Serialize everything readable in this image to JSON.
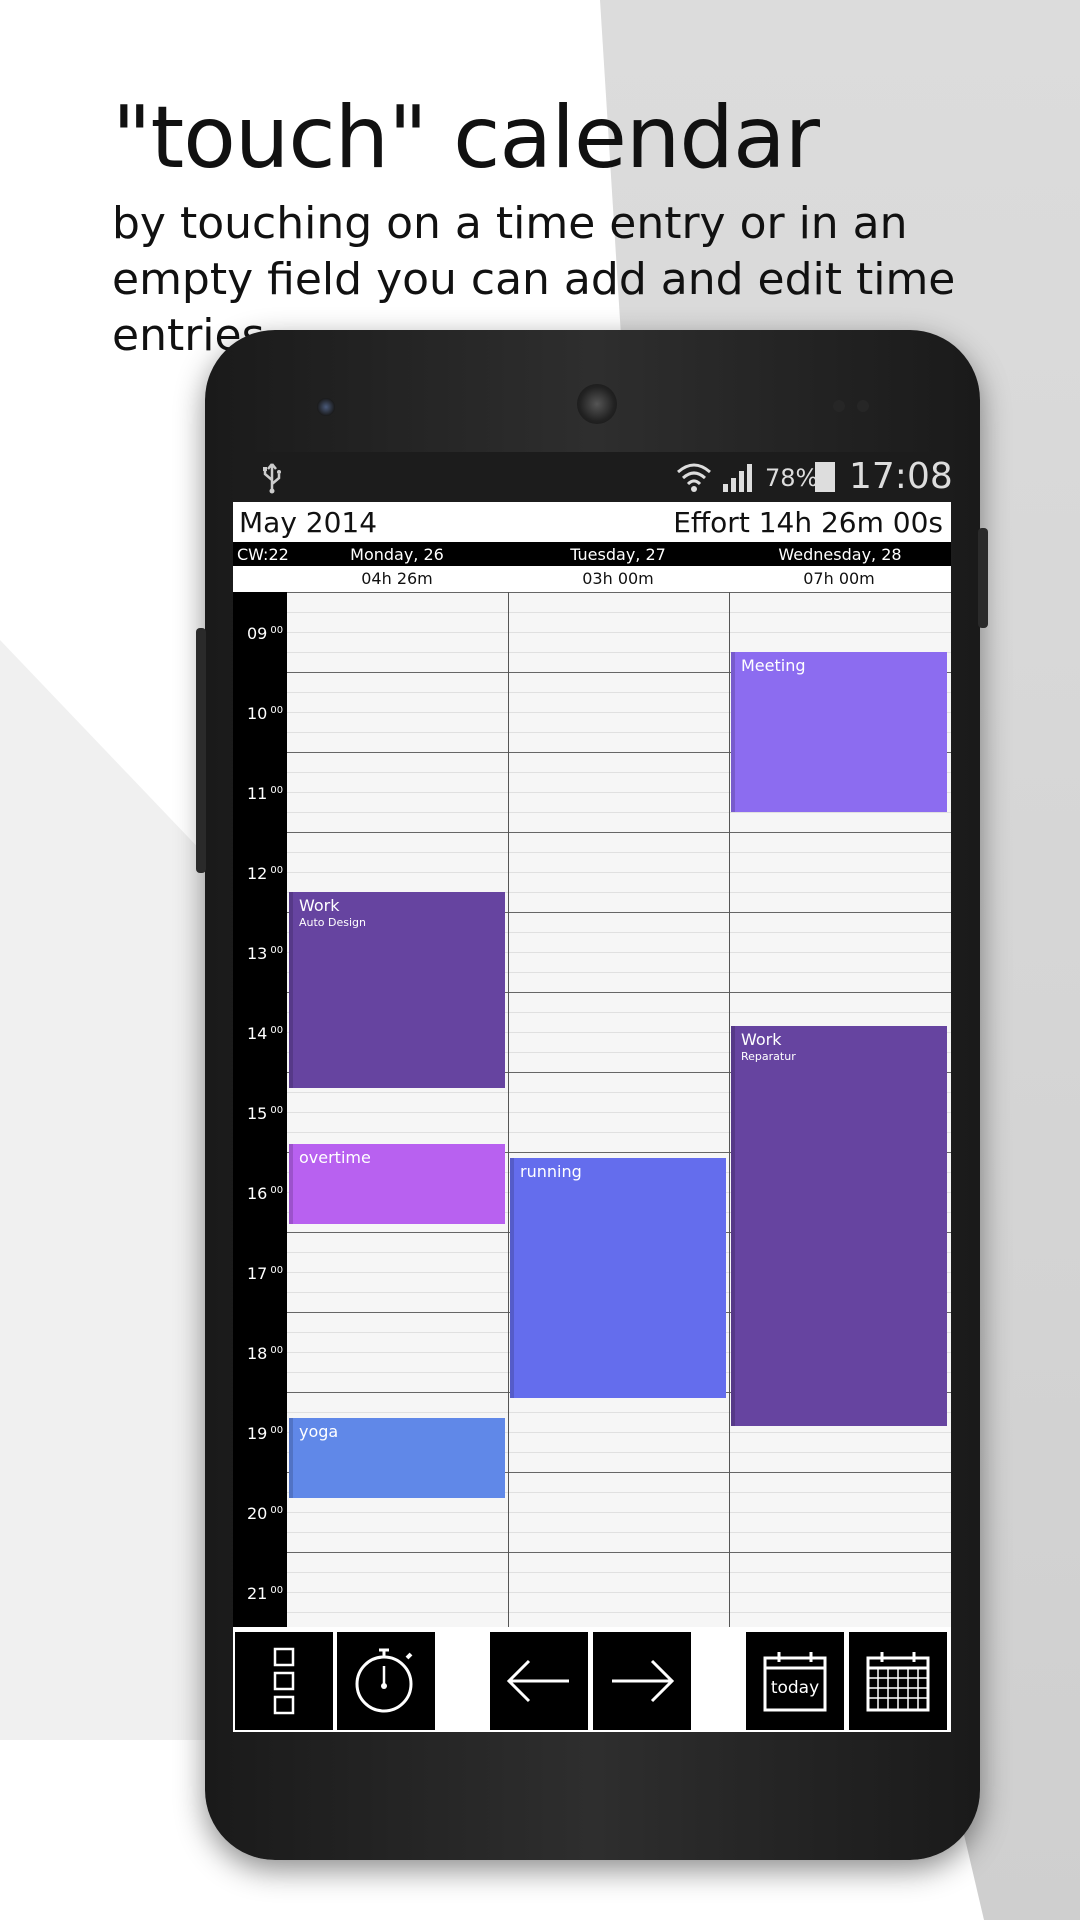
{
  "promo": {
    "title": "\"touch\" calendar",
    "subtitle": "by touching on a time entry or in an empty field you can add and edit time entries"
  },
  "statusbar": {
    "usb_icon": "usb-icon",
    "wifi_icon": "wifi-icon",
    "signal_icon": "signal-icon",
    "battery_percent": "78%",
    "battery_icon": "battery-charging-icon",
    "time": "17:08"
  },
  "header": {
    "month": "May 2014",
    "effort": "Effort 14h 26m 00s"
  },
  "week": {
    "cw": "CW:22",
    "days": [
      {
        "name": "Monday, 26",
        "total": "04h 26m"
      },
      {
        "name": "Tuesday, 27",
        "total": "03h 00m"
      },
      {
        "name": "Wednesday, 28",
        "total": "07h 00m"
      }
    ]
  },
  "hours": [
    {
      "h": "09",
      "m": "00"
    },
    {
      "h": "10",
      "m": "00"
    },
    {
      "h": "11",
      "m": "00"
    },
    {
      "h": "12",
      "m": "00"
    },
    {
      "h": "13",
      "m": "00"
    },
    {
      "h": "14",
      "m": "00"
    },
    {
      "h": "15",
      "m": "00"
    },
    {
      "h": "16",
      "m": "00"
    },
    {
      "h": "17",
      "m": "00"
    },
    {
      "h": "18",
      "m": "00"
    },
    {
      "h": "19",
      "m": "00"
    },
    {
      "h": "20",
      "m": "00"
    },
    {
      "h": "21",
      "m": "00"
    }
  ],
  "events": [
    {
      "day": 0,
      "title": "Work",
      "subtitle": "Auto Design",
      "start": 12.25,
      "end": 14.7,
      "color": "#6644a0"
    },
    {
      "day": 0,
      "title": "overtime",
      "subtitle": "",
      "start": 15.4,
      "end": 16.4,
      "color": "#b861f0"
    },
    {
      "day": 0,
      "title": "yoga",
      "subtitle": "",
      "start": 18.83,
      "end": 19.83,
      "color": "#6088e8"
    },
    {
      "day": 1,
      "title": "running",
      "subtitle": "",
      "start": 15.58,
      "end": 18.58,
      "color": "#646ded"
    },
    {
      "day": 2,
      "title": "Meeting",
      "subtitle": "",
      "start": 9.25,
      "end": 11.25,
      "color": "#8c6cf0"
    },
    {
      "day": 2,
      "title": "Work",
      "subtitle": "Reparatur",
      "start": 13.92,
      "end": 18.92,
      "color": "#6644a0"
    }
  ],
  "toolbar": {
    "menu_icon": "menu-squares-icon",
    "stopwatch_icon": "stopwatch-icon",
    "prev_icon": "arrow-left-icon",
    "next_icon": "arrow-right-icon",
    "today_label": "today",
    "month_icon": "month-calendar-icon"
  },
  "colors": {
    "toolbar_bg": "#000000",
    "grid_bg": "#f6f6f6"
  }
}
